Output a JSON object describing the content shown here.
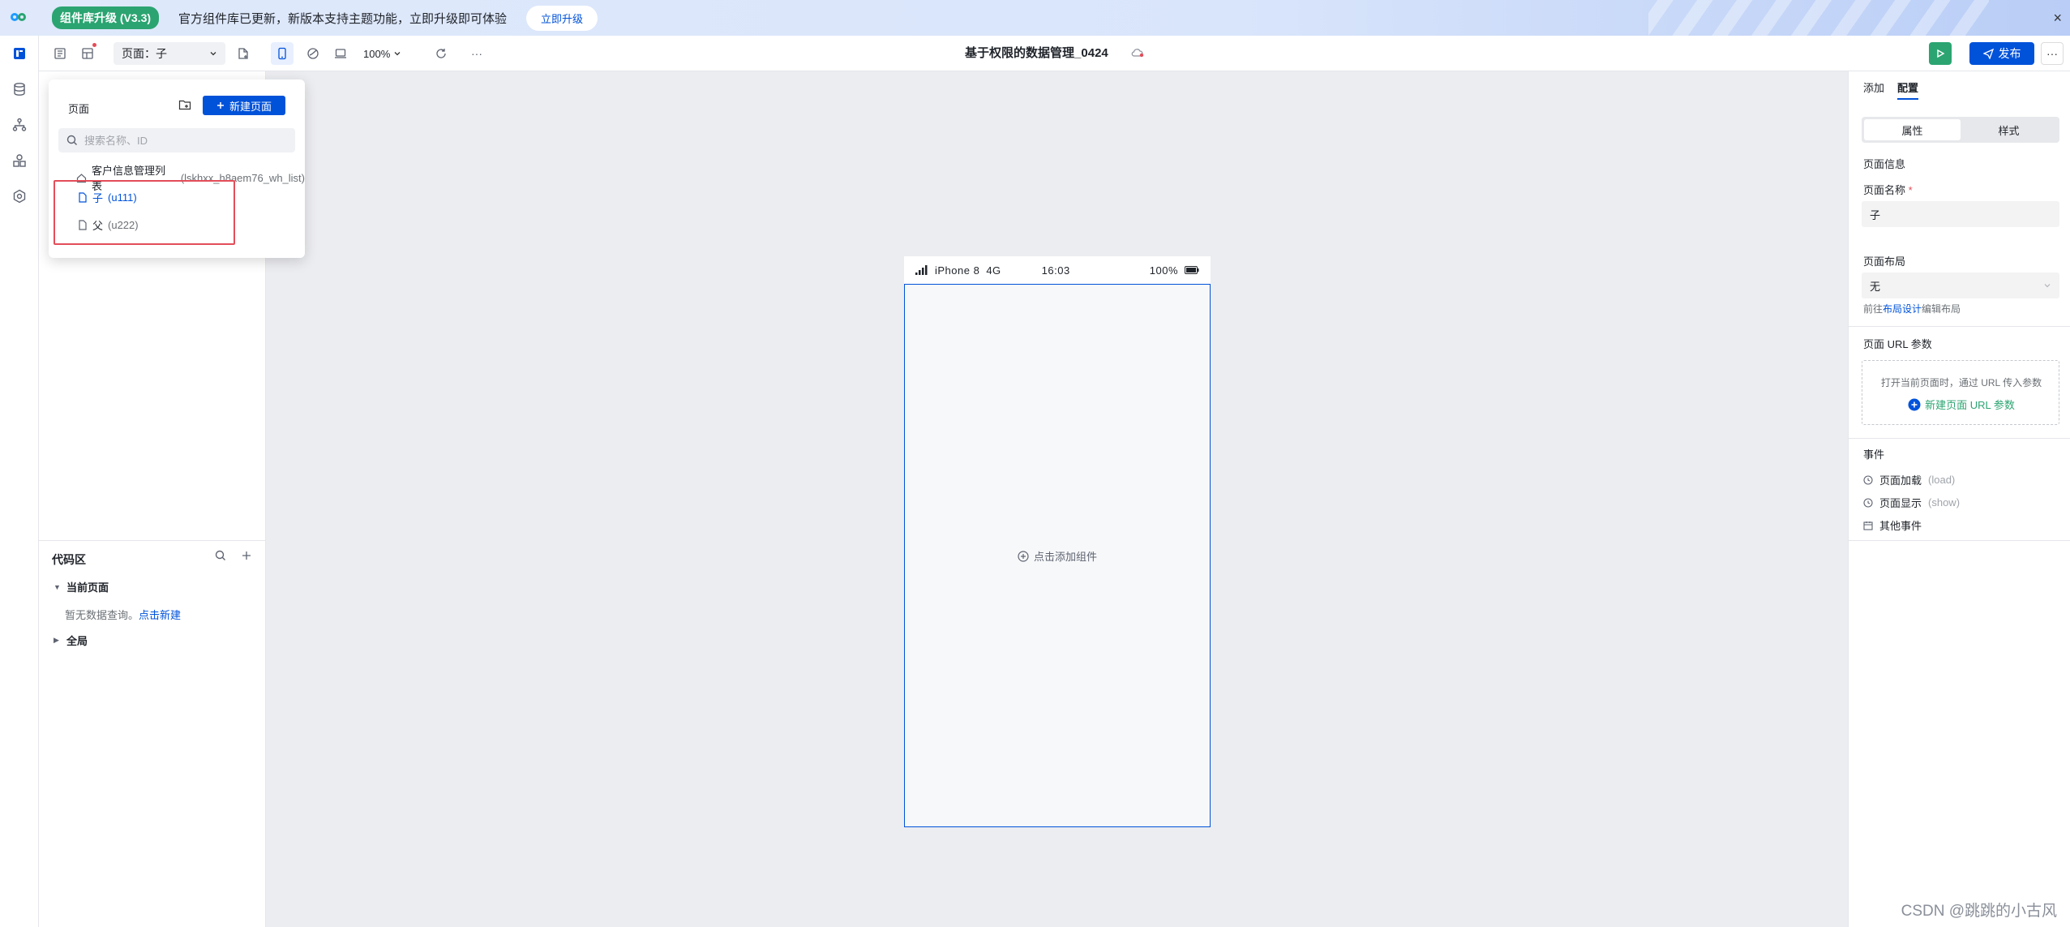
{
  "banner": {
    "badge": "组件库升级 (V3.3)",
    "text": "官方组件库已更新，新版本支持主题功能，立即升级即可体验",
    "button": "立即升级",
    "close": "×"
  },
  "toolbar": {
    "page_select": "页面：子",
    "zoom": "100%",
    "app_title": "基于权限的数据管理_0424",
    "publish": "发布",
    "more": "···"
  },
  "page_popup": {
    "title": "页面",
    "new_page": "新建页面",
    "search_placeholder": "搜索名称、ID",
    "pages": [
      {
        "name": "客户信息管理列表",
        "id": "(lskhxx_h8aem76_wh_list)"
      },
      {
        "name": "子",
        "id": "(u111)"
      },
      {
        "name": "父",
        "id": "(u222)"
      }
    ]
  },
  "code_area": {
    "title": "代码区",
    "current_page": "当前页面",
    "empty": "暂无数据查询。",
    "create": "点击新建",
    "global": "全局"
  },
  "phone": {
    "device": "iPhone 8",
    "network": "4G",
    "time": "16:03",
    "battery": "100%",
    "add_component": "点击添加组件"
  },
  "right_panel": {
    "tabs": [
      "添加",
      "配置"
    ],
    "segments": [
      "属性",
      "样式"
    ],
    "page_info": "页面信息",
    "page_name_label": "页面名称",
    "page_name_value": "子",
    "layout_label": "页面布局",
    "layout_value": "无",
    "layout_hint_prefix": "前往",
    "layout_hint_link": "布局设计",
    "layout_hint_suffix": "编辑布局",
    "url_params_label": "页面 URL 参数",
    "url_params_hint": "打开当前页面时，通过 URL 传入参数",
    "url_params_new": "新建页面 URL 参数",
    "events_label": "事件",
    "events": [
      {
        "name": "页面加载",
        "sub": "(load)"
      },
      {
        "name": "页面显示",
        "sub": "(show)"
      },
      {
        "name": "其他事件",
        "sub": ""
      }
    ]
  },
  "watermark": "CSDN @跳跳的小古风",
  "colors": {
    "primary": "#0052d9",
    "success": "#2ba471",
    "danger": "#e34d59"
  }
}
